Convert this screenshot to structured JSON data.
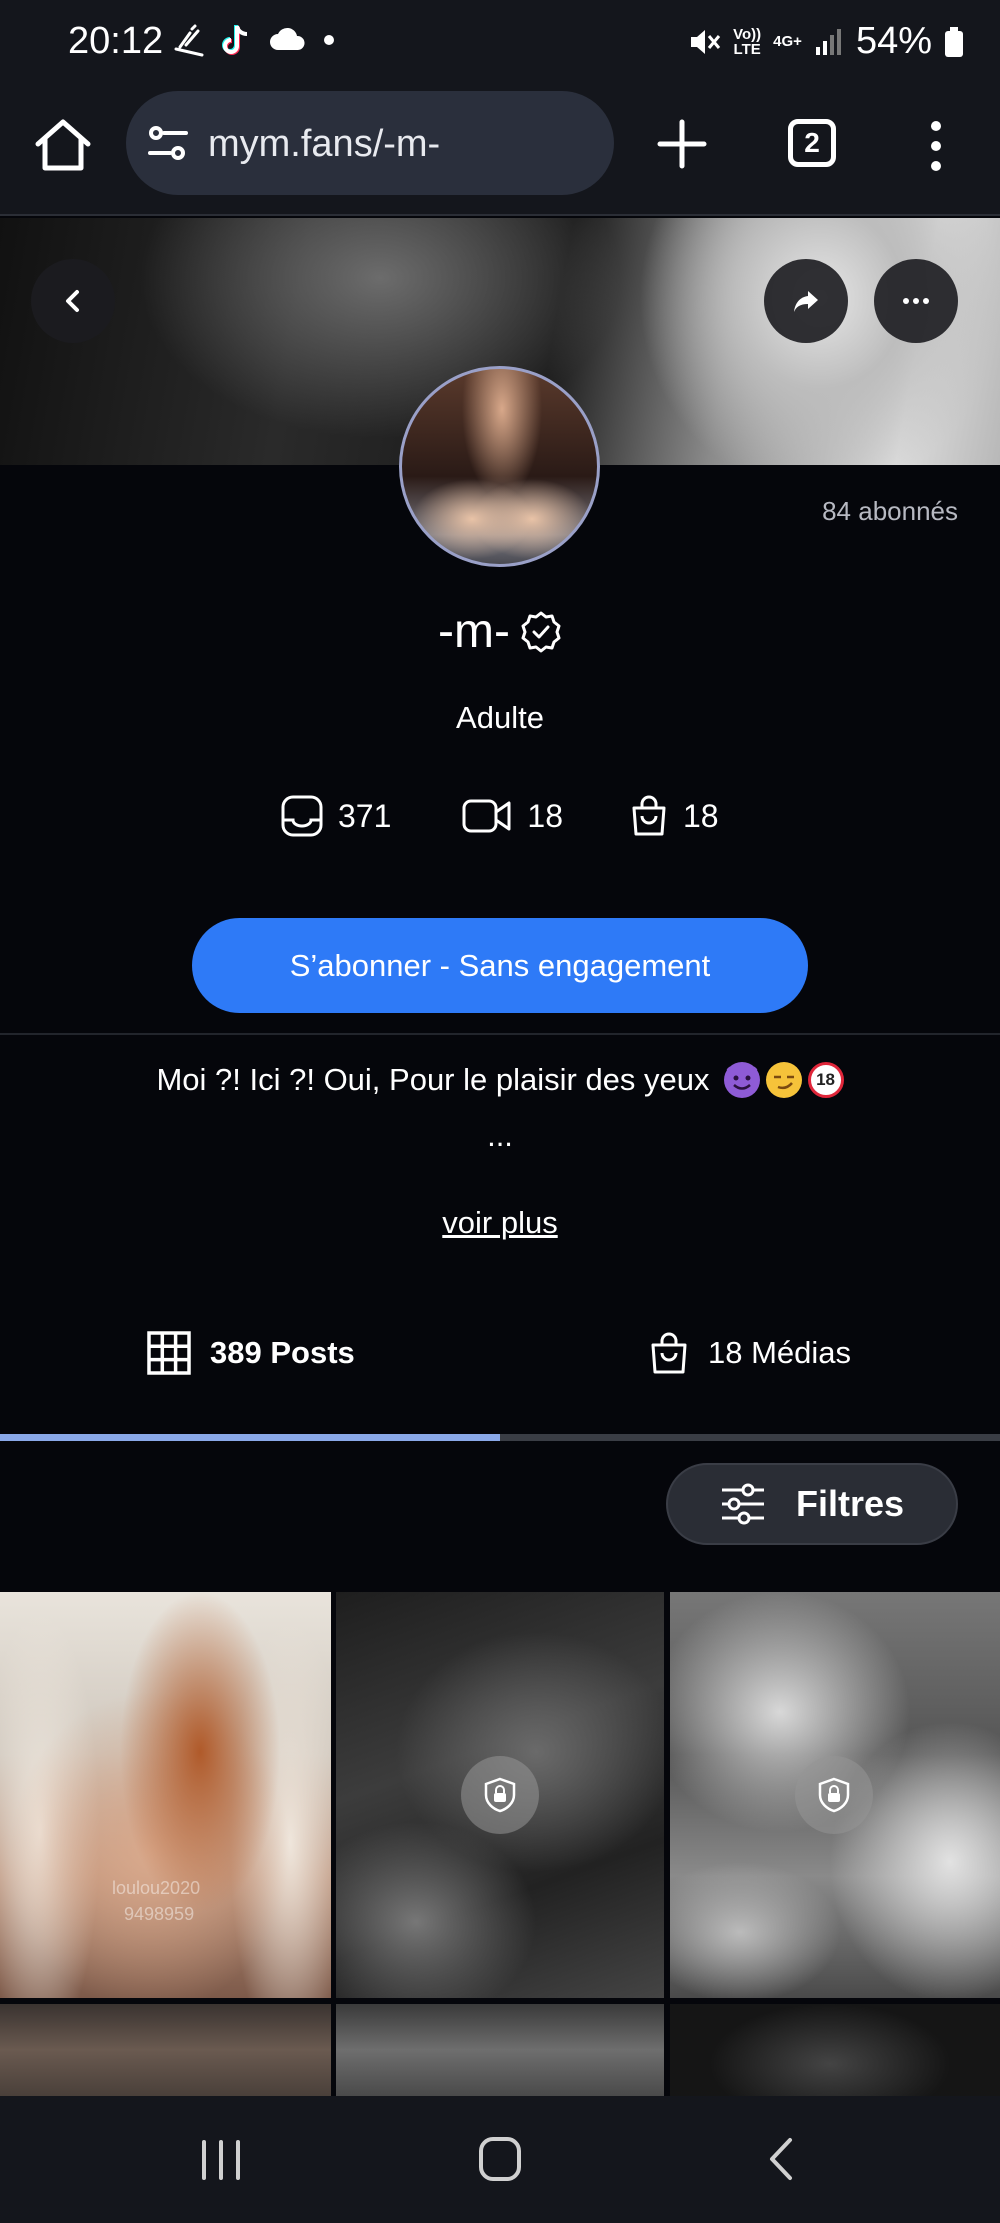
{
  "status_bar": {
    "time": "20:12",
    "battery": "54%",
    "network_top": "Vo))",
    "network_bottom": "LTE",
    "network_type": "4G+",
    "icons": [
      "ski-icon",
      "tiktok-icon",
      "cloud-icon",
      "dot-icon",
      "mute-icon",
      "signal-icon",
      "battery-icon"
    ]
  },
  "browser": {
    "url": "mym.fans/-m-",
    "tab_count": "2"
  },
  "profile": {
    "followers": "84 abonnés",
    "name": "-m-",
    "category": "Adulte",
    "stats": {
      "photos": "371",
      "videos": "18",
      "shop": "18"
    },
    "subscribe_label": "S’abonner - Sans engagement",
    "bio": "Moi ?! Ici ?! Oui, Pour le plaisir des yeux",
    "bio_emoji_badge": "18",
    "bio_ellipsis": "...",
    "see_more": "voir plus"
  },
  "tabs": {
    "posts": "389 Posts",
    "medias": "18 Médias",
    "active": "posts"
  },
  "filters_label": "Filtres",
  "grid": {
    "tile_watermark_1": "loulou2020",
    "tile_watermark_2": "9498959"
  },
  "colors": {
    "accent": "#2e7af7",
    "tab_indicator": "#8aa8e8",
    "background": "#05060b"
  }
}
